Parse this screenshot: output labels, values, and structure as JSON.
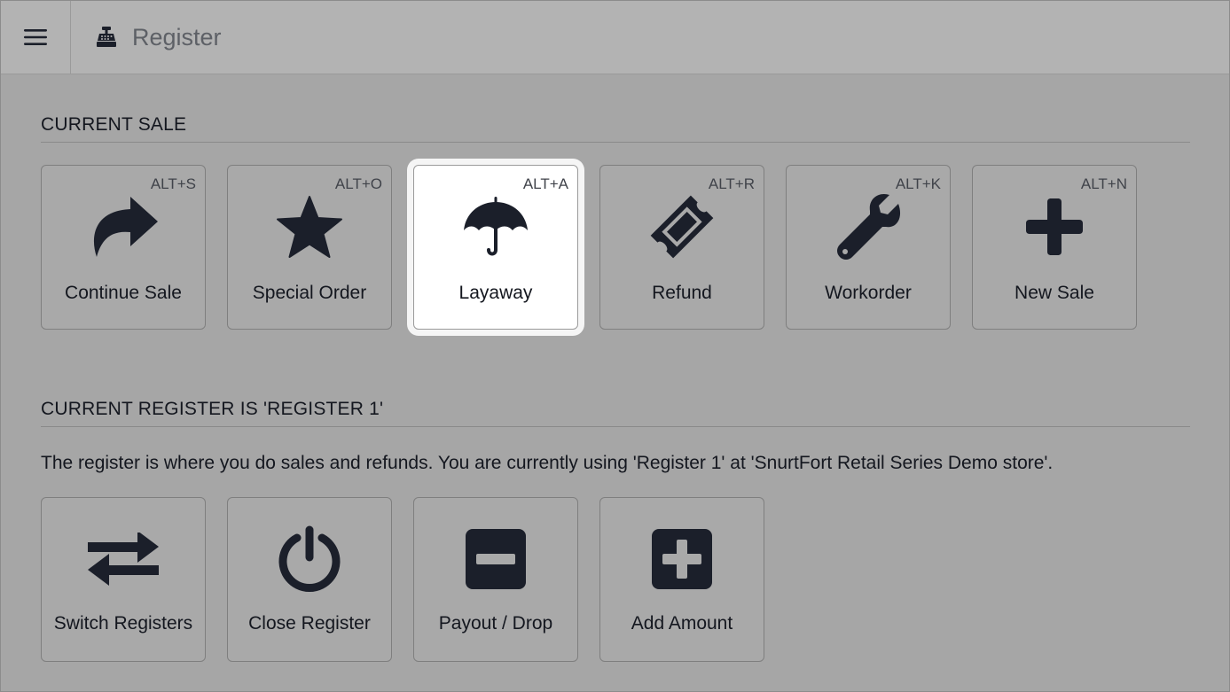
{
  "header": {
    "title": "Register",
    "menu_icon": "hamburger-menu-icon",
    "title_icon": "cash-register-icon"
  },
  "current_sale": {
    "heading": "CURRENT SALE",
    "tiles": [
      {
        "label": "Continue Sale",
        "shortcut": "ALT+S",
        "icon": "share-arrow-icon"
      },
      {
        "label": "Special Order",
        "shortcut": "ALT+O",
        "icon": "star-icon"
      },
      {
        "label": "Layaway",
        "shortcut": "ALT+A",
        "icon": "umbrella-icon",
        "selected": true
      },
      {
        "label": "Refund",
        "shortcut": "ALT+R",
        "icon": "ticket-icon"
      },
      {
        "label": "Workorder",
        "shortcut": "ALT+K",
        "icon": "wrench-icon"
      },
      {
        "label": "New Sale",
        "shortcut": "ALT+N",
        "icon": "plus-icon"
      }
    ]
  },
  "current_register": {
    "heading": "CURRENT REGISTER IS 'REGISTER 1'",
    "description": "The register is where you do sales and refunds. You are currently using 'Register 1'  at 'SnurtFort Retail Series Demo store'.",
    "tiles": [
      {
        "label": "Switch Registers",
        "icon": "exchange-arrows-icon"
      },
      {
        "label": "Close Register",
        "icon": "power-icon"
      },
      {
        "label": "Payout / Drop",
        "icon": "minus-square-icon"
      },
      {
        "label": "Add Amount",
        "icon": "plus-square-icon"
      }
    ]
  },
  "colors": {
    "icon": "#1b1f2a",
    "background": "#a6a6a6",
    "topbar": "#b3b3b3",
    "selected_tile": "#ffffff"
  }
}
